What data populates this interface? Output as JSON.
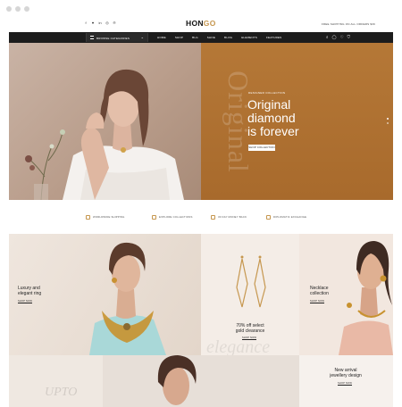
{
  "social_icons": [
    "facebook-icon",
    "twitter-icon",
    "linkedin-icon",
    "instagram-icon",
    "pinterest-icon"
  ],
  "social_glyphs": [
    "f",
    "♥",
    "in",
    "◎",
    "℗"
  ],
  "logo": {
    "main": "HON",
    "accent": "GO"
  },
  "topbar": {
    "shipping": "FREE SHIPPING ON ALL ORDERS $36"
  },
  "nav": {
    "category_label": "BROWSE CATEGORIES",
    "menu": [
      "HOME",
      "SHOP",
      "BLG",
      "SHOE",
      "BLOG",
      "ELEMENTS",
      "FEATURES"
    ]
  },
  "hero": {
    "eyebrow": "DESIGNER COLLECTION",
    "headline": [
      "Original",
      "diamond",
      "is forever"
    ],
    "cta": "SHOP COLLECTION",
    "vertical_word": "Original"
  },
  "features": [
    "WORLDWIDE SHIPPING",
    "EXPLORE COLLECTIONS",
    "30 DAY MONEY BACK",
    "DIPLOMATIC EXCHANGE"
  ],
  "tiles": {
    "ring": {
      "title": [
        "Luxury and",
        "elegant ring"
      ],
      "link": "SHOP NOW"
    },
    "gold": {
      "title": [
        "70% off select",
        "gold clearance"
      ],
      "link": "SHOP NOW",
      "script": "elegance"
    },
    "necklace": {
      "title": [
        "Necklace",
        "collection"
      ],
      "link": "SHOP NOW"
    },
    "arrival": {
      "title": [
        "New arrival",
        "jewellery design"
      ],
      "link": "SHOP NOW"
    },
    "script_bottom": "UPTO"
  },
  "colors": {
    "accent": "#c6974f",
    "hero_right": "#b57837",
    "nav": "#1c1c1c"
  }
}
